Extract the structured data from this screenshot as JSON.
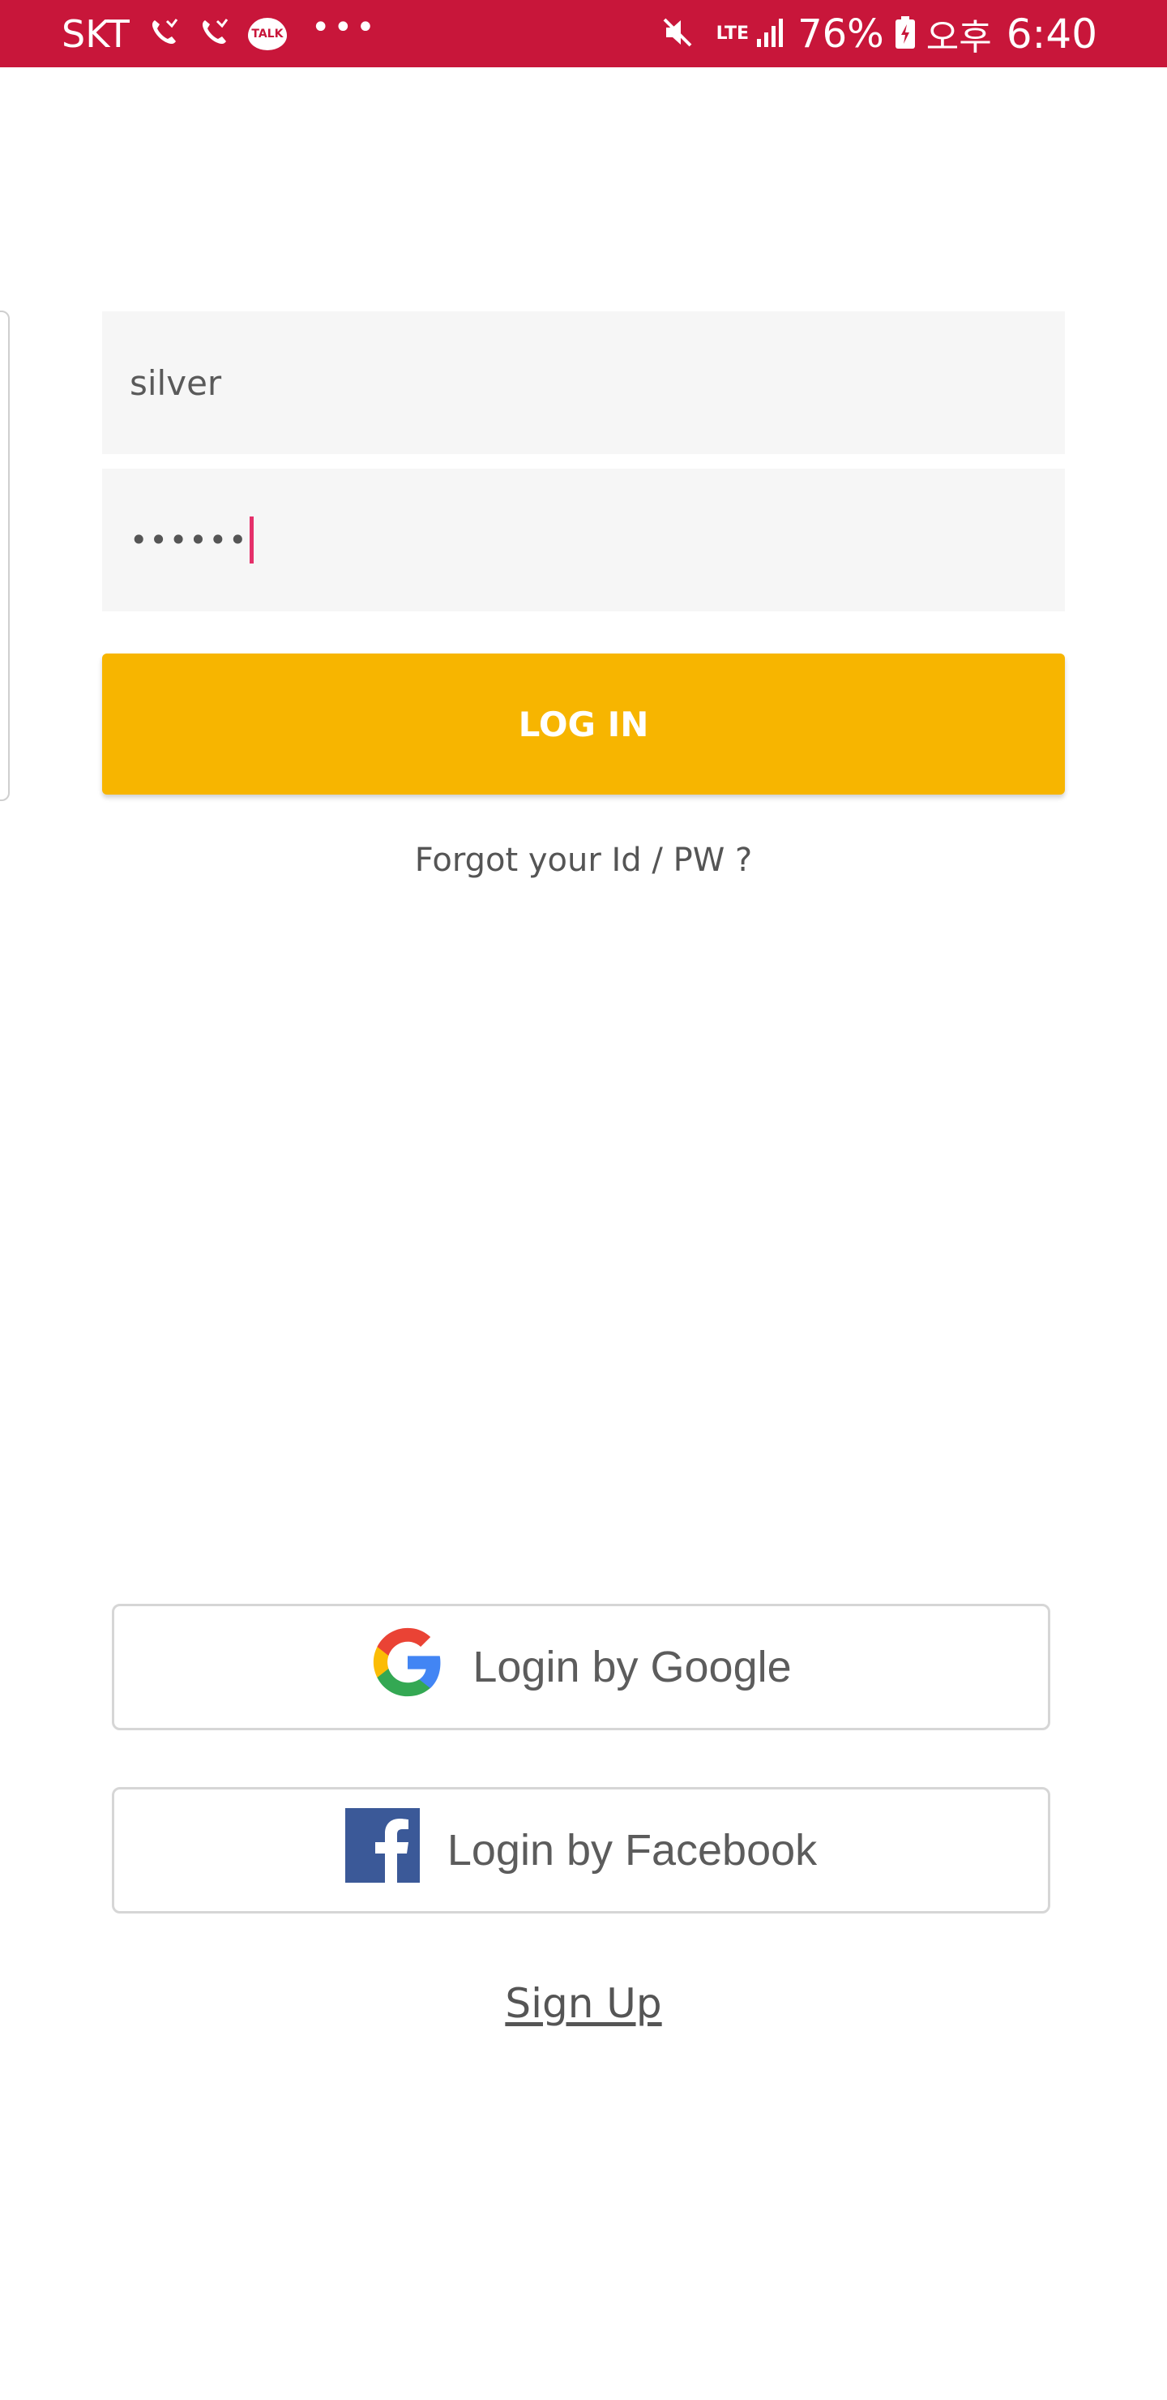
{
  "status_bar": {
    "carrier": "SKT",
    "talk_badge": "TALK",
    "more": "•••",
    "network": "LTE",
    "battery_percent": "76%",
    "ampm": "오후",
    "time": "6:40",
    "background_color": "#c8163a",
    "icons": [
      "phone-missed-icon",
      "phone-missed-icon",
      "kakaotalk-icon",
      "mute-icon",
      "signal-icon",
      "battery-charging-icon"
    ]
  },
  "login_form": {
    "username_value": "silver",
    "password_value": "••••••",
    "login_label": "LOG IN",
    "login_color": "#f7b500",
    "forgot_label": "Forgot your Id / PW ?"
  },
  "social": {
    "google_label": "Login by Google",
    "facebook_label": "Login by Facebook"
  },
  "signup": {
    "label": "Sign Up"
  }
}
